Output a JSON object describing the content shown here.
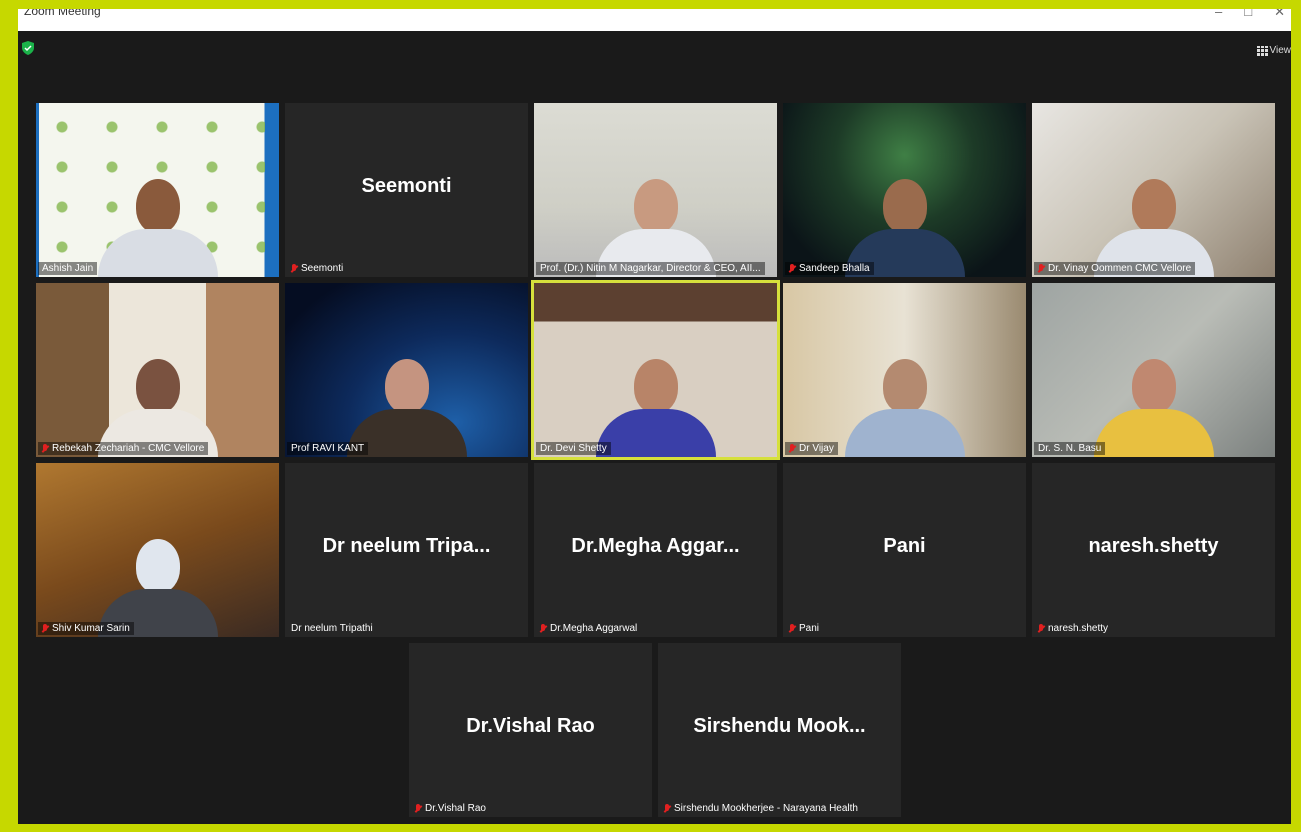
{
  "window": {
    "title": "Zoom Meeting",
    "view_label": "View"
  },
  "colors": {
    "accent_frame": "#c6d800",
    "active_border": "#d6e03c",
    "muted_mic": "#e02020",
    "tile_bg": "#262626"
  },
  "tiles": [
    {
      "id": "ashish",
      "name": "Ashish Jain",
      "display": "",
      "muted": false,
      "video": true
    },
    {
      "id": "seemonti",
      "name": "Seemonti",
      "display": "Seemonti",
      "muted": true,
      "video": false
    },
    {
      "id": "nitin",
      "name": "Prof. (Dr.) Nitin M Nagarkar, Director & CEO, AII...",
      "display": "",
      "muted": false,
      "video": true
    },
    {
      "id": "sandeep",
      "name": "Sandeep Bhalla",
      "display": "",
      "muted": true,
      "video": true
    },
    {
      "id": "vinay",
      "name": "Dr. Vinay Oommen CMC Vellore",
      "display": "",
      "muted": true,
      "video": true
    },
    {
      "id": "rebekah",
      "name": "Rebekah Zechariah - CMC Vellore",
      "display": "",
      "muted": true,
      "video": true
    },
    {
      "id": "ravi",
      "name": "Prof RAVI KANT",
      "display": "",
      "muted": false,
      "video": true
    },
    {
      "id": "devi",
      "name": "Dr. Devi Shetty",
      "display": "",
      "muted": false,
      "video": true,
      "active": true
    },
    {
      "id": "vijay",
      "name": "Dr Vijay",
      "display": "",
      "muted": true,
      "video": true
    },
    {
      "id": "basu",
      "name": "Dr. S. N. Basu",
      "display": "",
      "muted": false,
      "video": true
    },
    {
      "id": "sarin",
      "name": "Shiv Kumar Sarin",
      "display": "",
      "muted": true,
      "video": true
    },
    {
      "id": "neelum",
      "name": "Dr neelum Tripathi",
      "display": "Dr neelum Tripa...",
      "muted": false,
      "video": false
    },
    {
      "id": "megha",
      "name": "Dr.Megha Aggarwal",
      "display": "Dr.Megha Aggar...",
      "muted": true,
      "video": false
    },
    {
      "id": "pani",
      "name": "Pani",
      "display": "Pani",
      "muted": true,
      "video": false
    },
    {
      "id": "naresh",
      "name": "naresh.shetty",
      "display": "naresh.shetty",
      "muted": true,
      "video": false
    },
    {
      "id": "vishal",
      "name": "Dr.Vishal Rao",
      "display": "Dr.Vishal Rao",
      "muted": true,
      "video": false
    },
    {
      "id": "sirshendu",
      "name": "Sirshendu Mookherjee - Narayana Health",
      "display": "Sirshendu Mook...",
      "muted": true,
      "video": false
    }
  ]
}
